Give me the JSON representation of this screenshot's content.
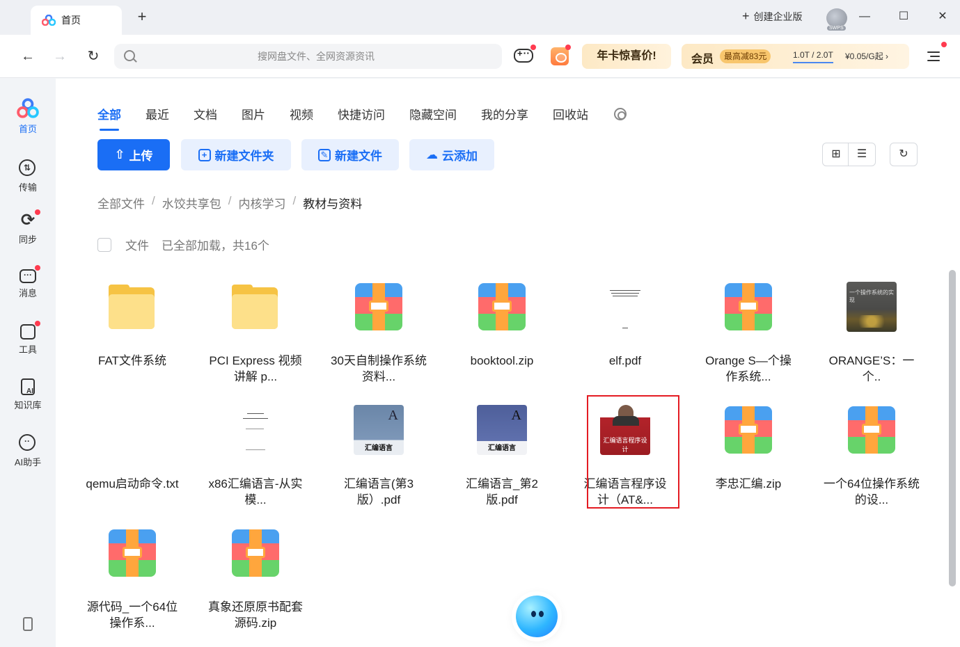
{
  "tab": {
    "title": "首页"
  },
  "titlebar": {
    "enterprise_label": "创建企业版",
    "avatar_tag": "SWPS"
  },
  "search": {
    "placeholder": "搜网盘文件、全网资源资讯"
  },
  "promo": {
    "annual": "年卡惊喜价!",
    "vip_label": "会员",
    "discount": "最高减83元",
    "size": "1.0T / 2.0T",
    "price": "¥0.05/G起 ›"
  },
  "sidebar": {
    "items": [
      {
        "label": "首页",
        "icon": "home-icon"
      },
      {
        "label": "传输",
        "icon": "transfer-icon"
      },
      {
        "label": "同步",
        "icon": "sync-icon"
      },
      {
        "label": "消息",
        "icon": "message-icon"
      },
      {
        "label": "工具",
        "icon": "tools-icon"
      },
      {
        "label": "知识库",
        "icon": "knowledge-icon",
        "ai_badge": "AI"
      },
      {
        "label": "AI助手",
        "icon": "ai-assistant-icon"
      }
    ]
  },
  "category_tabs": [
    "全部",
    "最近",
    "文档",
    "图片",
    "视频",
    "快捷访问",
    "隐藏空间",
    "我的分享",
    "回收站"
  ],
  "actions": {
    "upload": "上传",
    "new_folder": "新建文件夹",
    "new_file": "新建文件",
    "cloud_add": "云添加"
  },
  "breadcrumb": [
    "全部文件",
    "水饺共享包",
    "内核学习",
    "教材与资料"
  ],
  "list_header": {
    "label": "文件",
    "status": "已全部加载，共16个"
  },
  "files": [
    {
      "name": "FAT文件系统",
      "type": "folder"
    },
    {
      "name": "PCI Express 视频讲解 p...",
      "type": "folder"
    },
    {
      "name": "30天自制操作系统资料...",
      "type": "zip"
    },
    {
      "name": "booktool.zip",
      "type": "zip"
    },
    {
      "name": "elf.pdf",
      "type": "pdf"
    },
    {
      "name": "Orange S—个操作系统...",
      "type": "zip"
    },
    {
      "name": "ORANGE’S：一个..",
      "type": "book",
      "cover_text": "一个操作系统的实现"
    },
    {
      "name": "qemu启动命令.txt",
      "type": "txt"
    },
    {
      "name": "x86汇编语言-从实模...",
      "type": "pdf"
    },
    {
      "name": "汇编语言(第3版）.pdf",
      "type": "book",
      "cover_text": "汇编语言"
    },
    {
      "name": "汇编语言_第2版.pdf",
      "type": "book",
      "cover_text": "汇编语言"
    },
    {
      "name": "汇编语言程序设计（AT&...",
      "type": "book",
      "cover_text": "汇编语言程序设计"
    },
    {
      "name": "李忠汇编.zip",
      "type": "zip"
    },
    {
      "name": "一个64位操作系统的设...",
      "type": "zip"
    },
    {
      "name": "源代码_一个64位操作系...",
      "type": "zip"
    },
    {
      "name": "真象还原原书配套源码.zip",
      "type": "zip"
    }
  ],
  "colors": {
    "accent": "#1a6ef5",
    "highlight": "#e41b22",
    "badge": "#ff3b4f"
  }
}
